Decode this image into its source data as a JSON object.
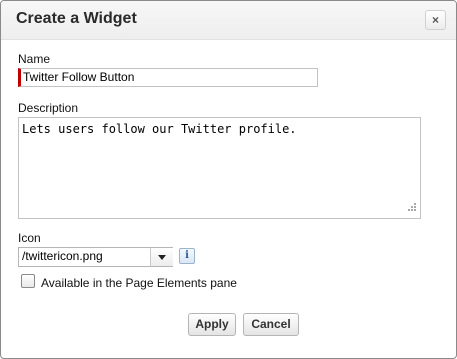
{
  "dialog": {
    "title": "Create a Widget",
    "close_label": "×"
  },
  "form": {
    "name_label": "Name",
    "name_value": "Twitter Follow Button",
    "description_label": "Description",
    "description_value": "Lets users follow our Twitter profile.",
    "icon_label": "Icon",
    "icon_selected": "/twittericon.png",
    "info_label": "i",
    "checkbox_label": "Available in the Page Elements pane",
    "checkbox_checked": false
  },
  "buttons": {
    "apply_label": "Apply",
    "cancel_label": "Cancel"
  },
  "colors": {
    "required_marker": "#c00000",
    "header_bg": "#f2f2f2"
  }
}
